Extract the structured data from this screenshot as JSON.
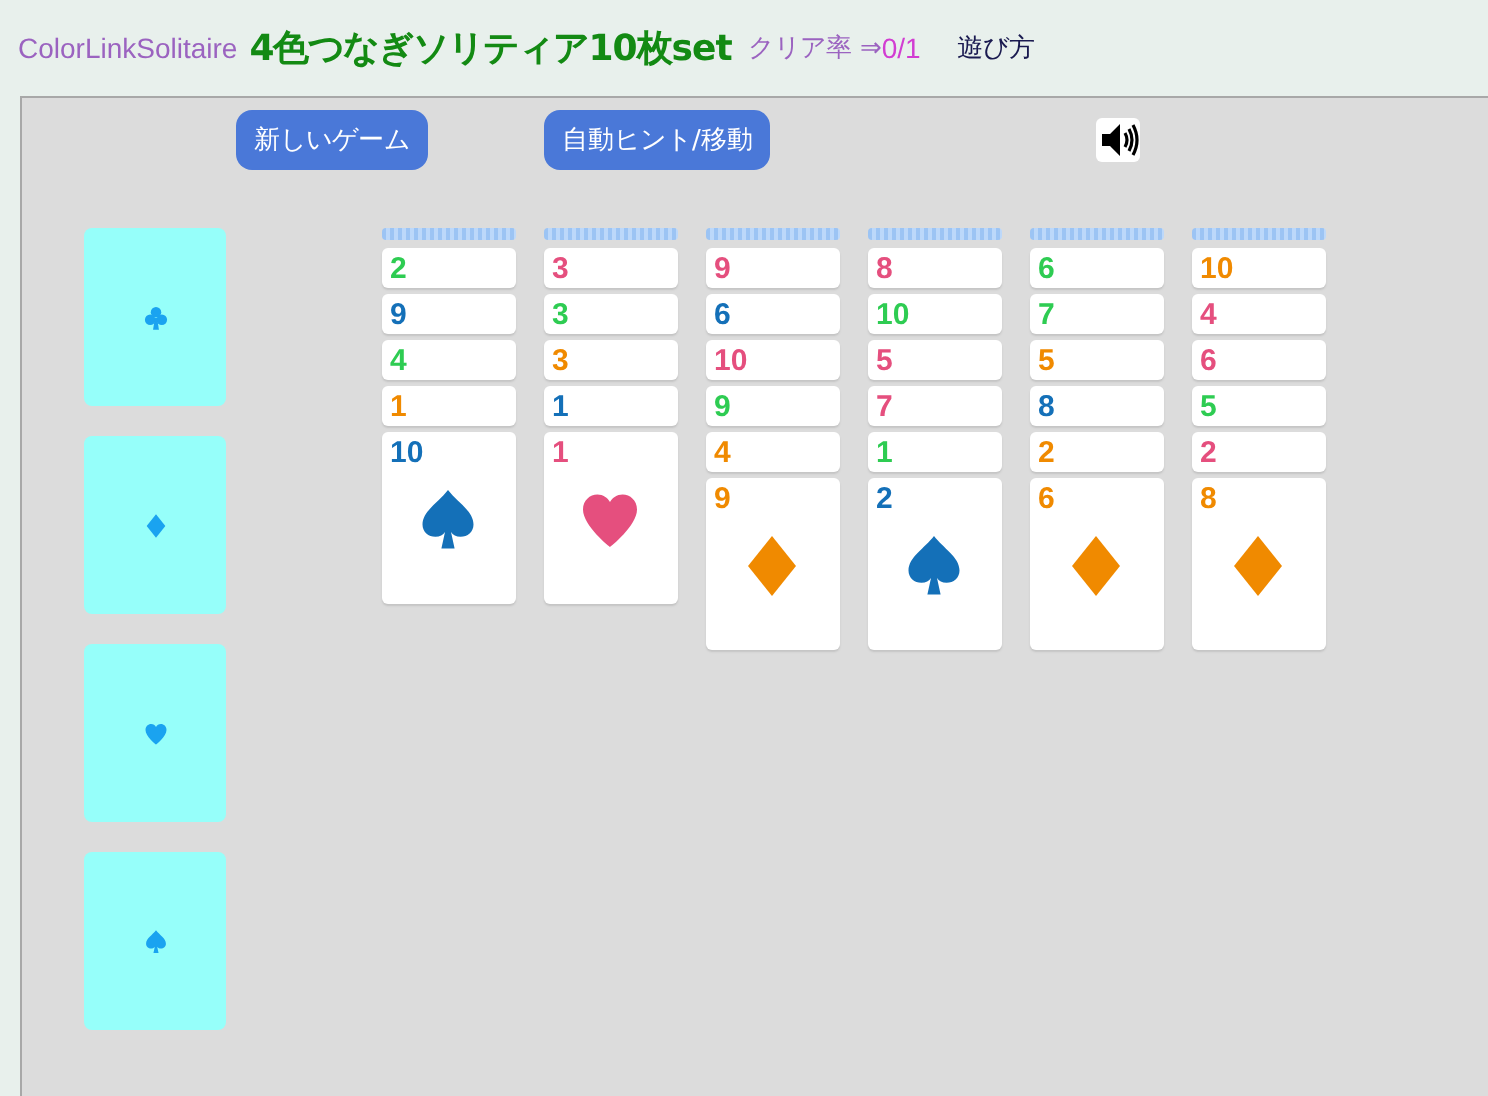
{
  "header": {
    "site_name": "ColorLinkSolitaire",
    "title": "4色つなぎソリティア10枚set",
    "clear_rate_label": "クリア率 ⇒",
    "clear_rate_value": "0/1",
    "help_link": "遊び方"
  },
  "buttons": [
    "新しいゲーム",
    "自動ヒント/移動"
  ],
  "foundations": [
    {
      "kind": "club"
    },
    {
      "kind": "diamond"
    },
    {
      "kind": "heart"
    },
    {
      "kind": "spade"
    }
  ],
  "columns": [
    {
      "cards": [
        {
          "rank": "2",
          "color": "#2ecc52"
        },
        {
          "rank": "9",
          "color": "#1470b8"
        },
        {
          "rank": "4",
          "color": "#2ecc52"
        },
        {
          "rank": "1",
          "color": "#f08a00"
        },
        {
          "rank": "10",
          "color": "#1470b8",
          "kind": "spade"
        }
      ]
    },
    {
      "cards": [
        {
          "rank": "3",
          "color": "#e54f7e"
        },
        {
          "rank": "3",
          "color": "#2ecc52"
        },
        {
          "rank": "3",
          "color": "#f08a00"
        },
        {
          "rank": "1",
          "color": "#1470b8"
        },
        {
          "rank": "1",
          "color": "#e54f7e",
          "kind": "heart"
        }
      ]
    },
    {
      "cards": [
        {
          "rank": "9",
          "color": "#e54f7e"
        },
        {
          "rank": "6",
          "color": "#1470b8"
        },
        {
          "rank": "10",
          "color": "#e54f7e"
        },
        {
          "rank": "9",
          "color": "#2ecc52"
        },
        {
          "rank": "4",
          "color": "#f08a00"
        },
        {
          "rank": "9",
          "color": "#f08a00",
          "kind": "diamond"
        }
      ]
    },
    {
      "cards": [
        {
          "rank": "8",
          "color": "#e54f7e"
        },
        {
          "rank": "10",
          "color": "#2ecc52"
        },
        {
          "rank": "5",
          "color": "#e54f7e"
        },
        {
          "rank": "7",
          "color": "#e54f7e"
        },
        {
          "rank": "1",
          "color": "#2ecc52"
        },
        {
          "rank": "2",
          "color": "#1470b8",
          "kind": "spade"
        }
      ]
    },
    {
      "cards": [
        {
          "rank": "6",
          "color": "#2ecc52"
        },
        {
          "rank": "7",
          "color": "#2ecc52"
        },
        {
          "rank": "5",
          "color": "#f08a00"
        },
        {
          "rank": "8",
          "color": "#1470b8"
        },
        {
          "rank": "2",
          "color": "#f08a00"
        },
        {
          "rank": "6",
          "color": "#f08a00",
          "kind": "diamond"
        }
      ]
    },
    {
      "cards": [
        {
          "rank": "10",
          "color": "#f08a00"
        },
        {
          "rank": "4",
          "color": "#e54f7e"
        },
        {
          "rank": "6",
          "color": "#e54f7e"
        },
        {
          "rank": "5",
          "color": "#2ecc52"
        },
        {
          "rank": "2",
          "color": "#e54f7e"
        },
        {
          "rank": "8",
          "color": "#f08a00",
          "kind": "diamond"
        }
      ]
    }
  ]
}
